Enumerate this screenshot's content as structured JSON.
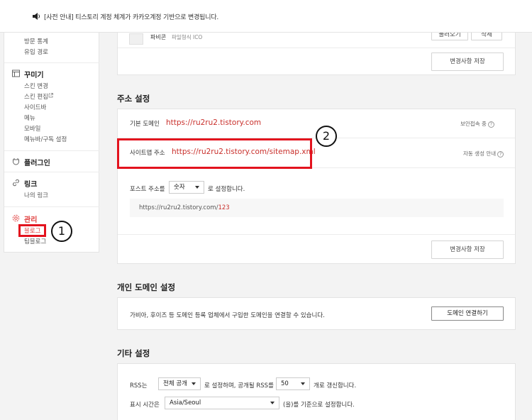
{
  "notice": {
    "text": "[사전 안내] 티스토리 계정 체계가 카카오계정 기반으로 변경됩니다."
  },
  "sidebar": {
    "stats_items": [
      "방문 통계",
      "유입 경로"
    ],
    "decorate": {
      "title": "꾸미기",
      "items": [
        "스킨 변경",
        "스킨 편집",
        "사이드바",
        "메뉴",
        "모바일",
        "메뉴바/구독 설정"
      ]
    },
    "plugin": {
      "title": "플러그인"
    },
    "link": {
      "title": "링크",
      "items": [
        "나의 링크"
      ]
    },
    "manage": {
      "title": "관리",
      "items": [
        "블로그",
        "팀블로그"
      ]
    }
  },
  "top_card": {
    "favicon_label": "파비콘",
    "favicon_hint": "파일형식 ICO",
    "browse_button": "불러오기",
    "delete_button": "삭제",
    "save_button": "변경사항 저장"
  },
  "address": {
    "title": "주소 설정",
    "default_domain_label": "기본 도메인",
    "default_domain_url": "https://ru2ru2.tistory.com",
    "secure_note": "보안접속 중",
    "sitemap_label": "사이트맵 주소",
    "sitemap_url": "https://ru2ru2.tistory.com/sitemap.xml",
    "auto_note": "자동 생성 안내",
    "post_addr_prefix": "포스트 주소를",
    "post_addr_select": "숫자",
    "post_addr_suffix": "로 설정합니다.",
    "example_base": "https://ru2ru2.tistory.com/",
    "example_num": "123",
    "save_button": "변경사항 저장"
  },
  "personal_domain": {
    "title": "개인 도메인 설정",
    "desc": "가비아, 후이즈 등 도메인 등록 업체에서 구입한 도메인을 연결할 수 있습니다.",
    "connect_button": "도메인 연결하기"
  },
  "etc": {
    "title": "기타 설정",
    "rss_prefix": "RSS는",
    "rss_select": "전체 공개",
    "rss_mid": "로 설정하며, 공개될 RSS를",
    "rss_count": "50",
    "rss_suffix": "개로 갱신합니다.",
    "tz_prefix": "표시 시간은",
    "tz_select": "Asia/Seoul",
    "tz_suffix": "(을)를 기준으로 설정합니다."
  },
  "annotations": {
    "one": "1",
    "two": "2"
  },
  "colors": {
    "accent_red": "#e0403f",
    "annotation_red": "#e3131e"
  }
}
